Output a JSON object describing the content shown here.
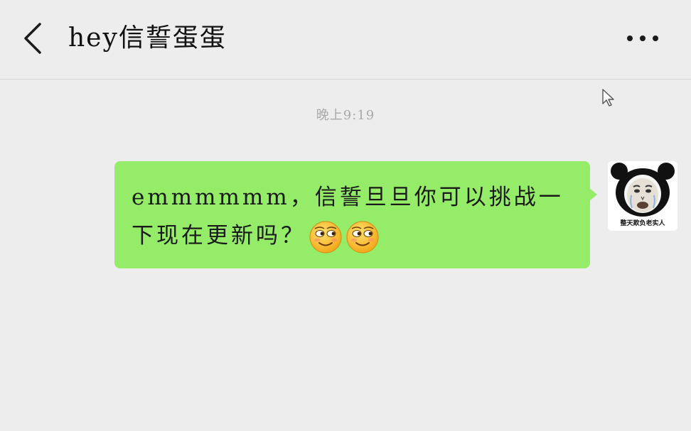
{
  "header": {
    "title": "hey信誓蛋蛋",
    "back_icon": "chevron-left-icon",
    "more_icon": "more-horizontal-icon"
  },
  "chat": {
    "timestamp": "晚上9:19",
    "messages": [
      {
        "sender": "self",
        "text": "emmmmmm，信誓旦旦你可以挑战一下现在更新吗？",
        "emojis": [
          "smirk-emoji",
          "smirk-emoji"
        ],
        "bubble_color": "#95ec69",
        "avatar": {
          "icon": "panda-meme-avatar",
          "caption": "整天欺负老实人"
        }
      }
    ]
  },
  "colors": {
    "background": "#ededed",
    "bubble_self": "#95ec69",
    "timestamp_text": "#a9a9a9"
  }
}
